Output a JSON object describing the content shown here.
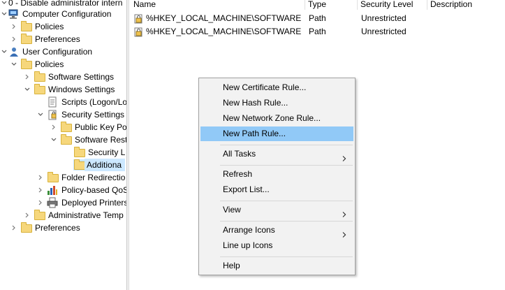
{
  "tree": {
    "items": [
      {
        "label": "0 - Disable administrator intern",
        "icon": "policy-object-icon",
        "chev": "down"
      },
      {
        "label": "Computer Configuration",
        "icon": "computer-icon",
        "chev": "down"
      },
      {
        "label": "Policies",
        "icon": "folder-icon",
        "chev": "right"
      },
      {
        "label": "Preferences",
        "icon": "folder-icon",
        "chev": "right"
      },
      {
        "label": "User Configuration",
        "icon": "user-icon",
        "chev": "down"
      },
      {
        "label": "Policies",
        "icon": "folder-icon",
        "chev": "down"
      },
      {
        "label": "Software Settings",
        "icon": "folder-icon",
        "chev": "right"
      },
      {
        "label": "Windows Settings",
        "icon": "folder-icon",
        "chev": "down"
      },
      {
        "label": "Scripts (Logon/Lo",
        "icon": "script-icon",
        "chev": "none"
      },
      {
        "label": "Security Settings",
        "icon": "security-icon",
        "chev": "down"
      },
      {
        "label": "Public Key Po",
        "icon": "folder-icon",
        "chev": "right"
      },
      {
        "label": "Software Rest",
        "icon": "folder-icon",
        "chev": "down"
      },
      {
        "label": "Security L",
        "icon": "folder-icon",
        "chev": "none"
      },
      {
        "label": "Additiona",
        "icon": "folder-icon",
        "chev": "none",
        "selected": true
      },
      {
        "label": "Folder Redirectio",
        "icon": "folder-icon",
        "chev": "right"
      },
      {
        "label": "Policy-based QoS",
        "icon": "chart-icon",
        "chev": "right"
      },
      {
        "label": "Deployed Printers",
        "icon": "printer-icon",
        "chev": "right"
      },
      {
        "label": "Administrative Temp",
        "icon": "folder-icon",
        "chev": "right"
      },
      {
        "label": "Preferences",
        "icon": "folder-icon",
        "chev": "right"
      }
    ]
  },
  "list": {
    "columns": [
      "Name",
      "Type",
      "Security Level",
      "Description"
    ],
    "rows": [
      {
        "name": "%HKEY_LOCAL_MACHINE\\SOFTWARE\\...",
        "type": "Path",
        "level": "Unrestricted",
        "description": ""
      },
      {
        "name": "%HKEY_LOCAL_MACHINE\\SOFTWARE\\...",
        "type": "Path",
        "level": "Unrestricted",
        "description": ""
      }
    ]
  },
  "context_menu": {
    "items": [
      {
        "label": "New Certificate Rule..."
      },
      {
        "label": "New Hash Rule..."
      },
      {
        "label": "New Network Zone Rule..."
      },
      {
        "label": "New Path Rule...",
        "highlighted": true
      },
      {
        "label": "All Tasks",
        "submenu": true
      },
      {
        "label": "Refresh"
      },
      {
        "label": "Export List..."
      },
      {
        "label": "View",
        "submenu": true
      },
      {
        "label": "Arrange Icons",
        "submenu": true
      },
      {
        "label": "Line up Icons"
      },
      {
        "label": "Help"
      }
    ]
  },
  "colors": {
    "menu_highlight": "#91c9f7",
    "tree_selection": "#cce8ff",
    "menu_background": "#f2f2f2"
  }
}
